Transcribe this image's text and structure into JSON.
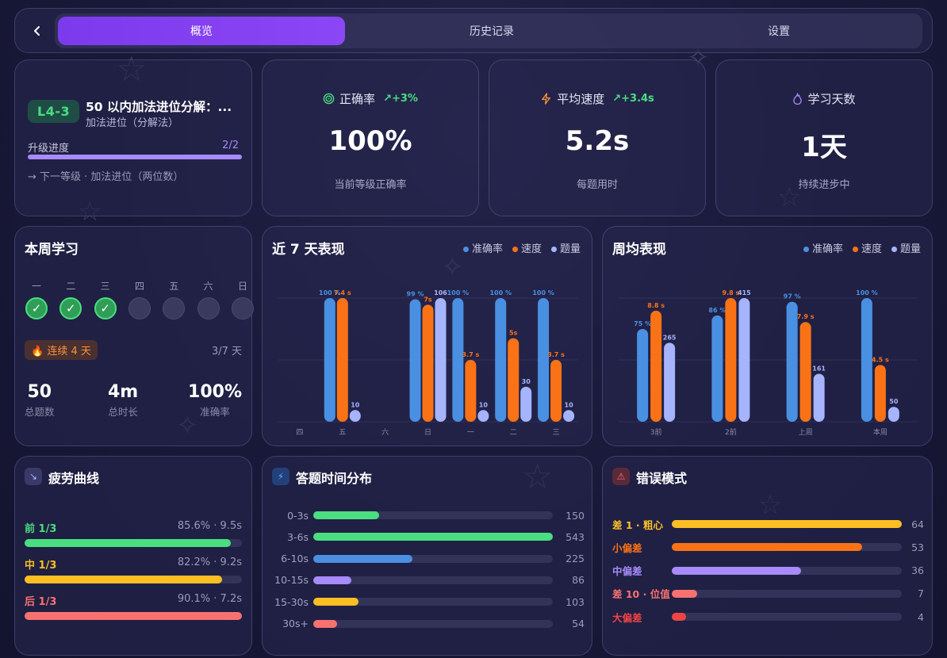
{
  "nav": {
    "tabs": [
      {
        "label": "概览",
        "active": true
      },
      {
        "label": "历史记录",
        "active": false
      },
      {
        "label": "设置",
        "active": false
      }
    ]
  },
  "level": {
    "badge": "L4-3",
    "title": "50 以内加法进位分解：...",
    "subtitle": "加法进位（分解法）",
    "progress_label": "升级进度",
    "progress_value": "2/2",
    "progress_fraction": 1.0,
    "next_text": "→ 下一等级 · 加法进位（两位数）"
  },
  "stats": {
    "accuracy": {
      "label": "正确率",
      "trend": "+3%",
      "value": "100%",
      "sub": "当前等级正确率",
      "icon": "target-icon"
    },
    "speed": {
      "label": "平均速度",
      "trend": "+3.4s",
      "value": "5.2s",
      "sub": "每题用时",
      "icon": "bolt-icon"
    },
    "days": {
      "label": "学习天数",
      "value": "1天",
      "sub": "持续进步中",
      "icon": "flame-icon"
    }
  },
  "week": {
    "title": "本周学习",
    "days": [
      {
        "label": "一",
        "done": true
      },
      {
        "label": "二",
        "done": true
      },
      {
        "label": "三",
        "done": true
      },
      {
        "label": "四",
        "done": false
      },
      {
        "label": "五",
        "done": false
      },
      {
        "label": "六",
        "done": false
      },
      {
        "label": "日",
        "done": false
      }
    ],
    "check": "✓",
    "streak": "连续 4 天",
    "streak_count": "3/7 天",
    "totals": [
      {
        "value": "50",
        "label": "总题数"
      },
      {
        "value": "4m",
        "label": "总时长"
      },
      {
        "value": "100%",
        "label": "准确率"
      }
    ]
  },
  "legend": {
    "accuracy": "准确率",
    "speed": "速度",
    "count": "题量"
  },
  "colors": {
    "accuracy": "#4a90e2",
    "speed": "#f97316",
    "count": "#a5b4fc",
    "purple": "#7c3aed",
    "green": "#4ade80",
    "yellow": "#fbbf24",
    "red": "#f87171"
  },
  "chart_data": [
    {
      "type": "bar",
      "title": "近 7 天表现",
      "categories": [
        "四",
        "五",
        "六",
        "日",
        "一",
        "二",
        "三"
      ],
      "series": [
        {
          "name": "准确率",
          "values": [
            null,
            100,
            null,
            99,
            100,
            100,
            100
          ],
          "labels": [
            "",
            "100 %",
            "",
            "99 %",
            "100 %",
            "100 %",
            "100 %"
          ]
        },
        {
          "name": "速度",
          "values": [
            null,
            7.4,
            null,
            7,
            3.7,
            5,
            3.7
          ],
          "labels": [
            "",
            "7.4 s",
            "",
            "7s",
            "3.7 s",
            "5s",
            "3.7 s"
          ]
        },
        {
          "name": "题量",
          "values": [
            null,
            10,
            null,
            106,
            10,
            30,
            10
          ],
          "labels": [
            "",
            "10",
            "",
            "106",
            "10",
            "30",
            "10"
          ]
        }
      ]
    },
    {
      "type": "bar",
      "title": "周均表现",
      "categories": [
        "3前",
        "2前",
        "上周",
        "本周"
      ],
      "series": [
        {
          "name": "准确率",
          "values": [
            75,
            86,
            97,
            100
          ],
          "labels": [
            "75 %",
            "86 %",
            "97 %",
            "100 %"
          ]
        },
        {
          "name": "速度",
          "values": [
            8.8,
            9.8,
            7.9,
            4.5
          ],
          "labels": [
            "8.8 s",
            "9.8 s",
            "7.9 s",
            "4.5 s"
          ]
        },
        {
          "name": "题量",
          "values": [
            265,
            415,
            161,
            50
          ],
          "labels": [
            "265",
            "415",
            "161",
            "50"
          ]
        }
      ]
    }
  ],
  "fatigue": {
    "title": "疲劳曲线",
    "rows": [
      {
        "name": "前 1/3",
        "value": "85.6% · 9.5s",
        "fraction": 0.95,
        "color": "#4ade80"
      },
      {
        "name": "中 1/3",
        "value": "82.2% · 9.2s",
        "fraction": 0.91,
        "color": "#fbbf24"
      },
      {
        "name": "后 1/3",
        "value": "90.1% · 7.2s",
        "fraction": 1.0,
        "color": "#f87171"
      }
    ]
  },
  "distribution": {
    "title": "答题时间分布",
    "rows": [
      {
        "label": "0-3s",
        "value": 150,
        "color": "#4ade80"
      },
      {
        "label": "3-6s",
        "value": 543,
        "color": "#4ade80"
      },
      {
        "label": "6-10s",
        "value": 225,
        "color": "#4a90e2"
      },
      {
        "label": "10-15s",
        "value": 86,
        "color": "#a78bfa"
      },
      {
        "label": "15-30s",
        "value": 103,
        "color": "#fbbf24"
      },
      {
        "label": "30s+",
        "value": 54,
        "color": "#f87171"
      }
    ]
  },
  "errors": {
    "title": "错误模式",
    "rows": [
      {
        "label": "差 1 · 粗心",
        "value": 64,
        "color": "#fbbf24"
      },
      {
        "label": "小偏差",
        "value": 53,
        "color": "#f97316"
      },
      {
        "label": "中偏差",
        "value": 36,
        "color": "#a78bfa"
      },
      {
        "label": "差 10 · 位值",
        "value": 7,
        "color": "#f87171"
      },
      {
        "label": "大偏差",
        "value": 4,
        "color": "#ef4444"
      }
    ]
  }
}
